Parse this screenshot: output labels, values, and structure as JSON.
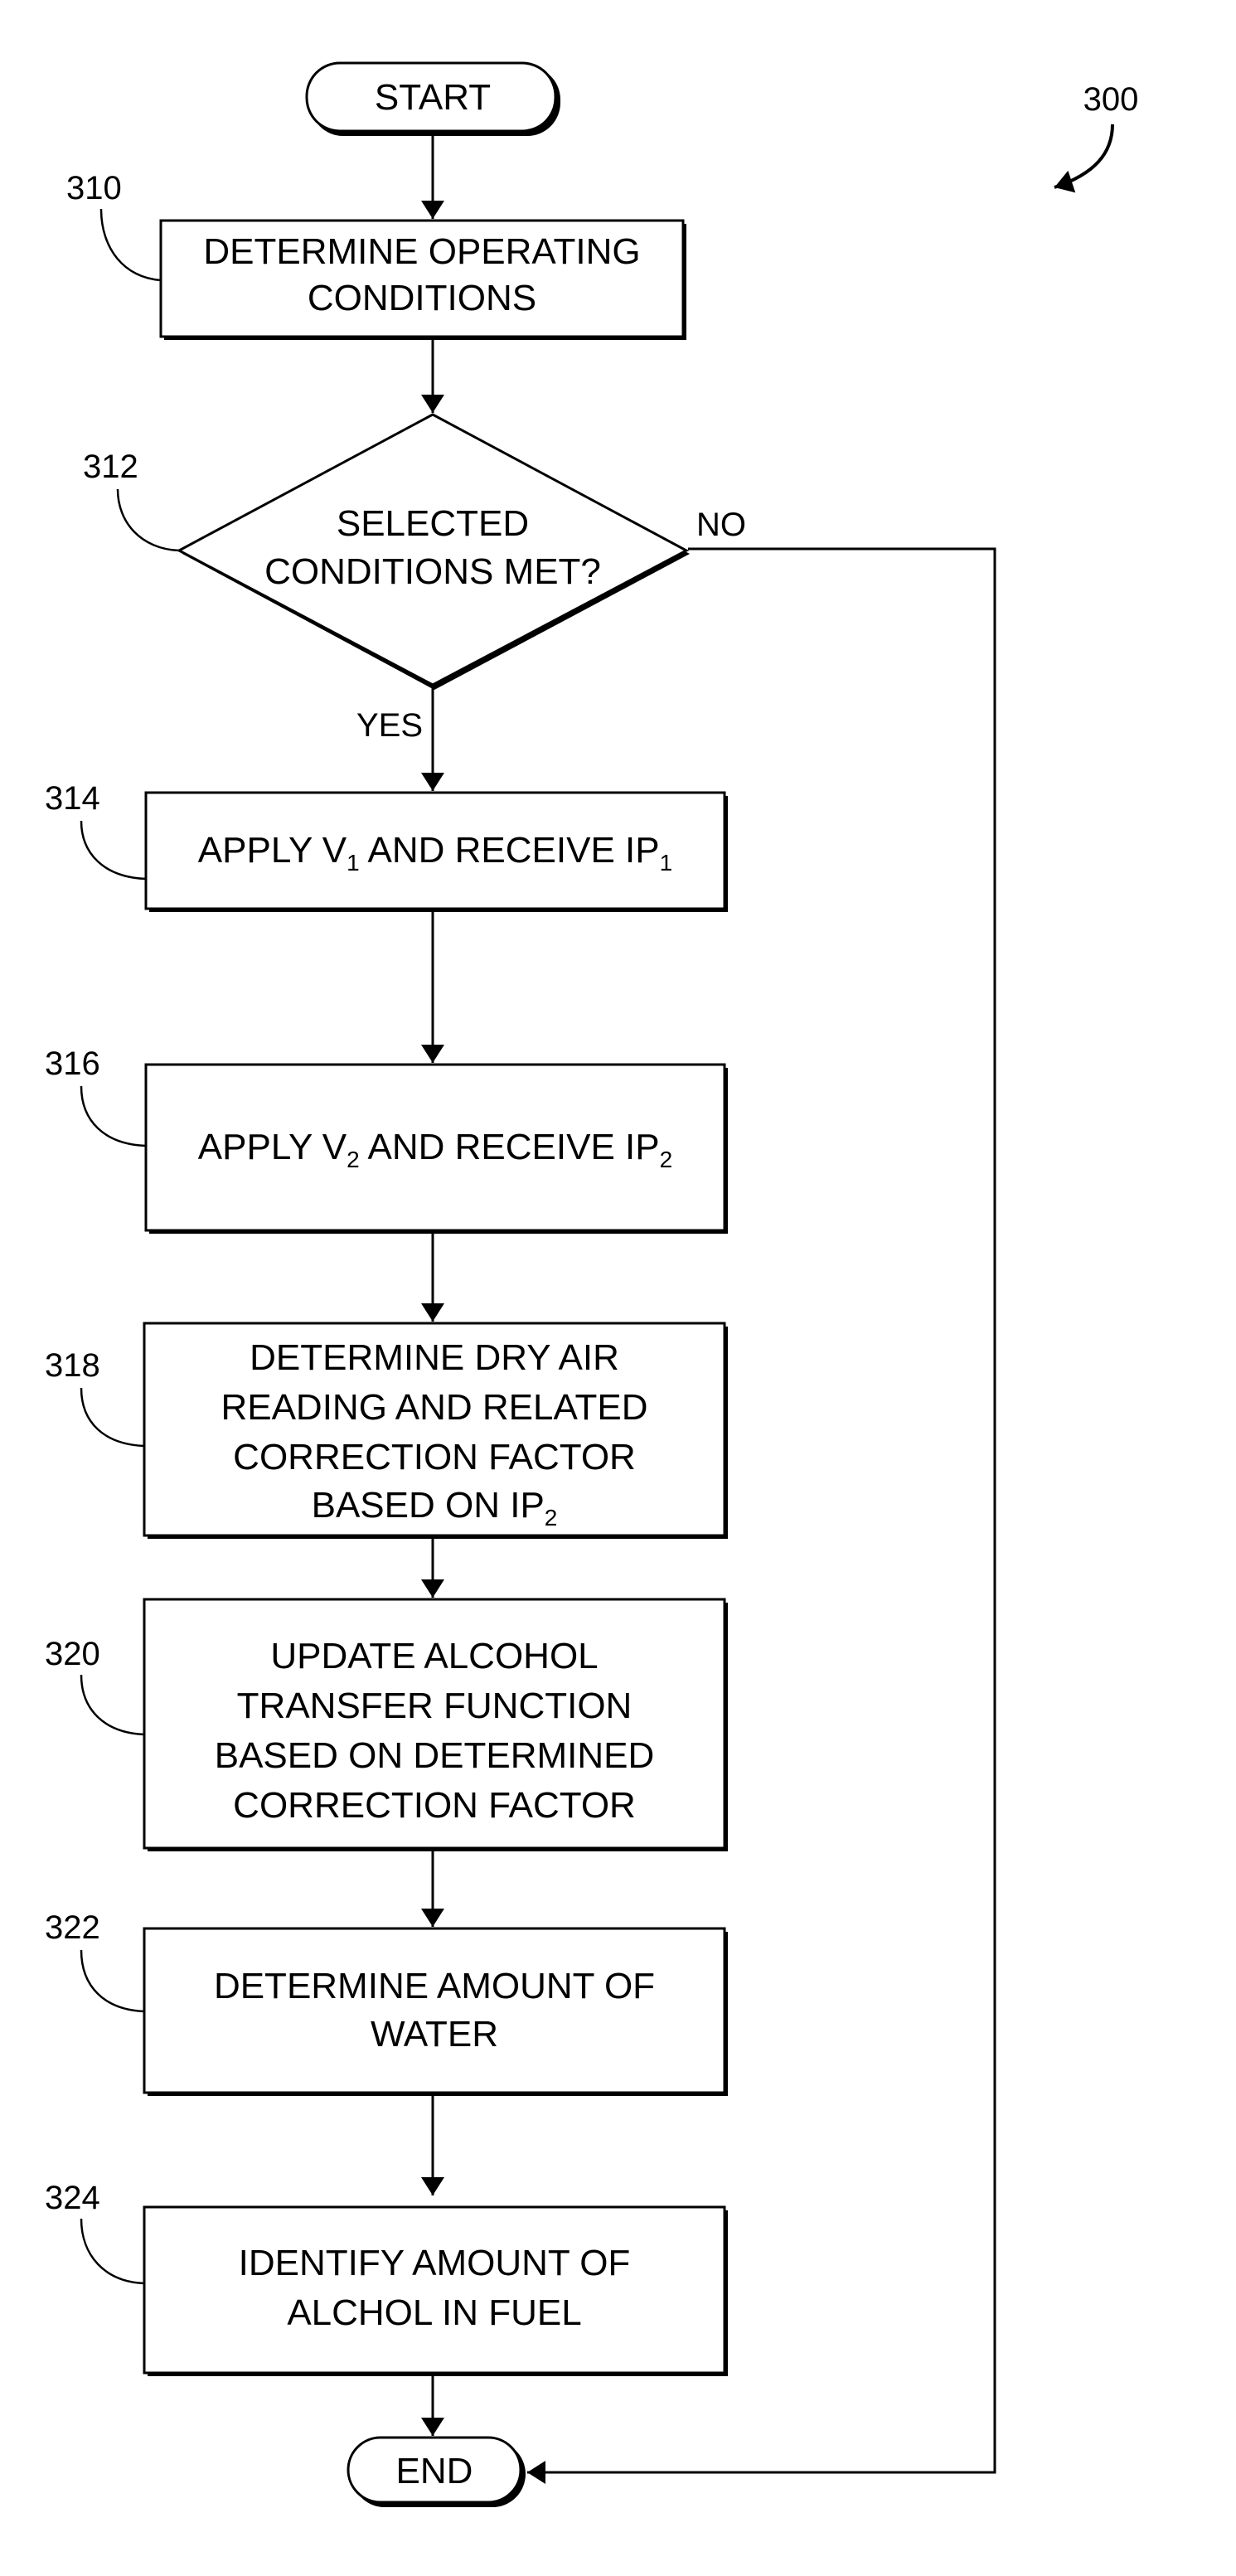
{
  "figure": {
    "reference": "300",
    "start": "START",
    "end": "END",
    "steps": [
      {
        "id": "310",
        "kind": "process",
        "lines": [
          "DETERMINE OPERATING",
          "CONDITIONS"
        ]
      },
      {
        "id": "312",
        "kind": "decision",
        "lines": [
          "SELECTED",
          "CONDITIONS MET?"
        ],
        "yes_label": "YES",
        "no_label": "NO"
      },
      {
        "id": "314",
        "kind": "process",
        "text": "APPLY V",
        "sub1": "1",
        "text2": " AND RECEIVE IP",
        "sub2": "1"
      },
      {
        "id": "316",
        "kind": "process",
        "text": "APPLY V",
        "sub1": "2",
        "text2": " AND RECEIVE IP",
        "sub2": "2"
      },
      {
        "id": "318",
        "kind": "process",
        "lines": [
          "DETERMINE DRY AIR",
          "READING AND RELATED",
          "CORRECTION FACTOR"
        ],
        "last_line": "BASED ON IP",
        "last_sub": "2"
      },
      {
        "id": "320",
        "kind": "process",
        "lines": [
          "UPDATE ALCOHOL",
          "TRANSFER FUNCTION",
          "BASED ON DETERMINED",
          "CORRECTION FACTOR"
        ]
      },
      {
        "id": "322",
        "kind": "process",
        "lines": [
          "DETERMINE AMOUNT OF",
          "WATER"
        ]
      },
      {
        "id": "324",
        "kind": "process",
        "lines": [
          "IDENTIFY AMOUNT OF",
          "ALCHOL IN FUEL"
        ]
      }
    ]
  }
}
